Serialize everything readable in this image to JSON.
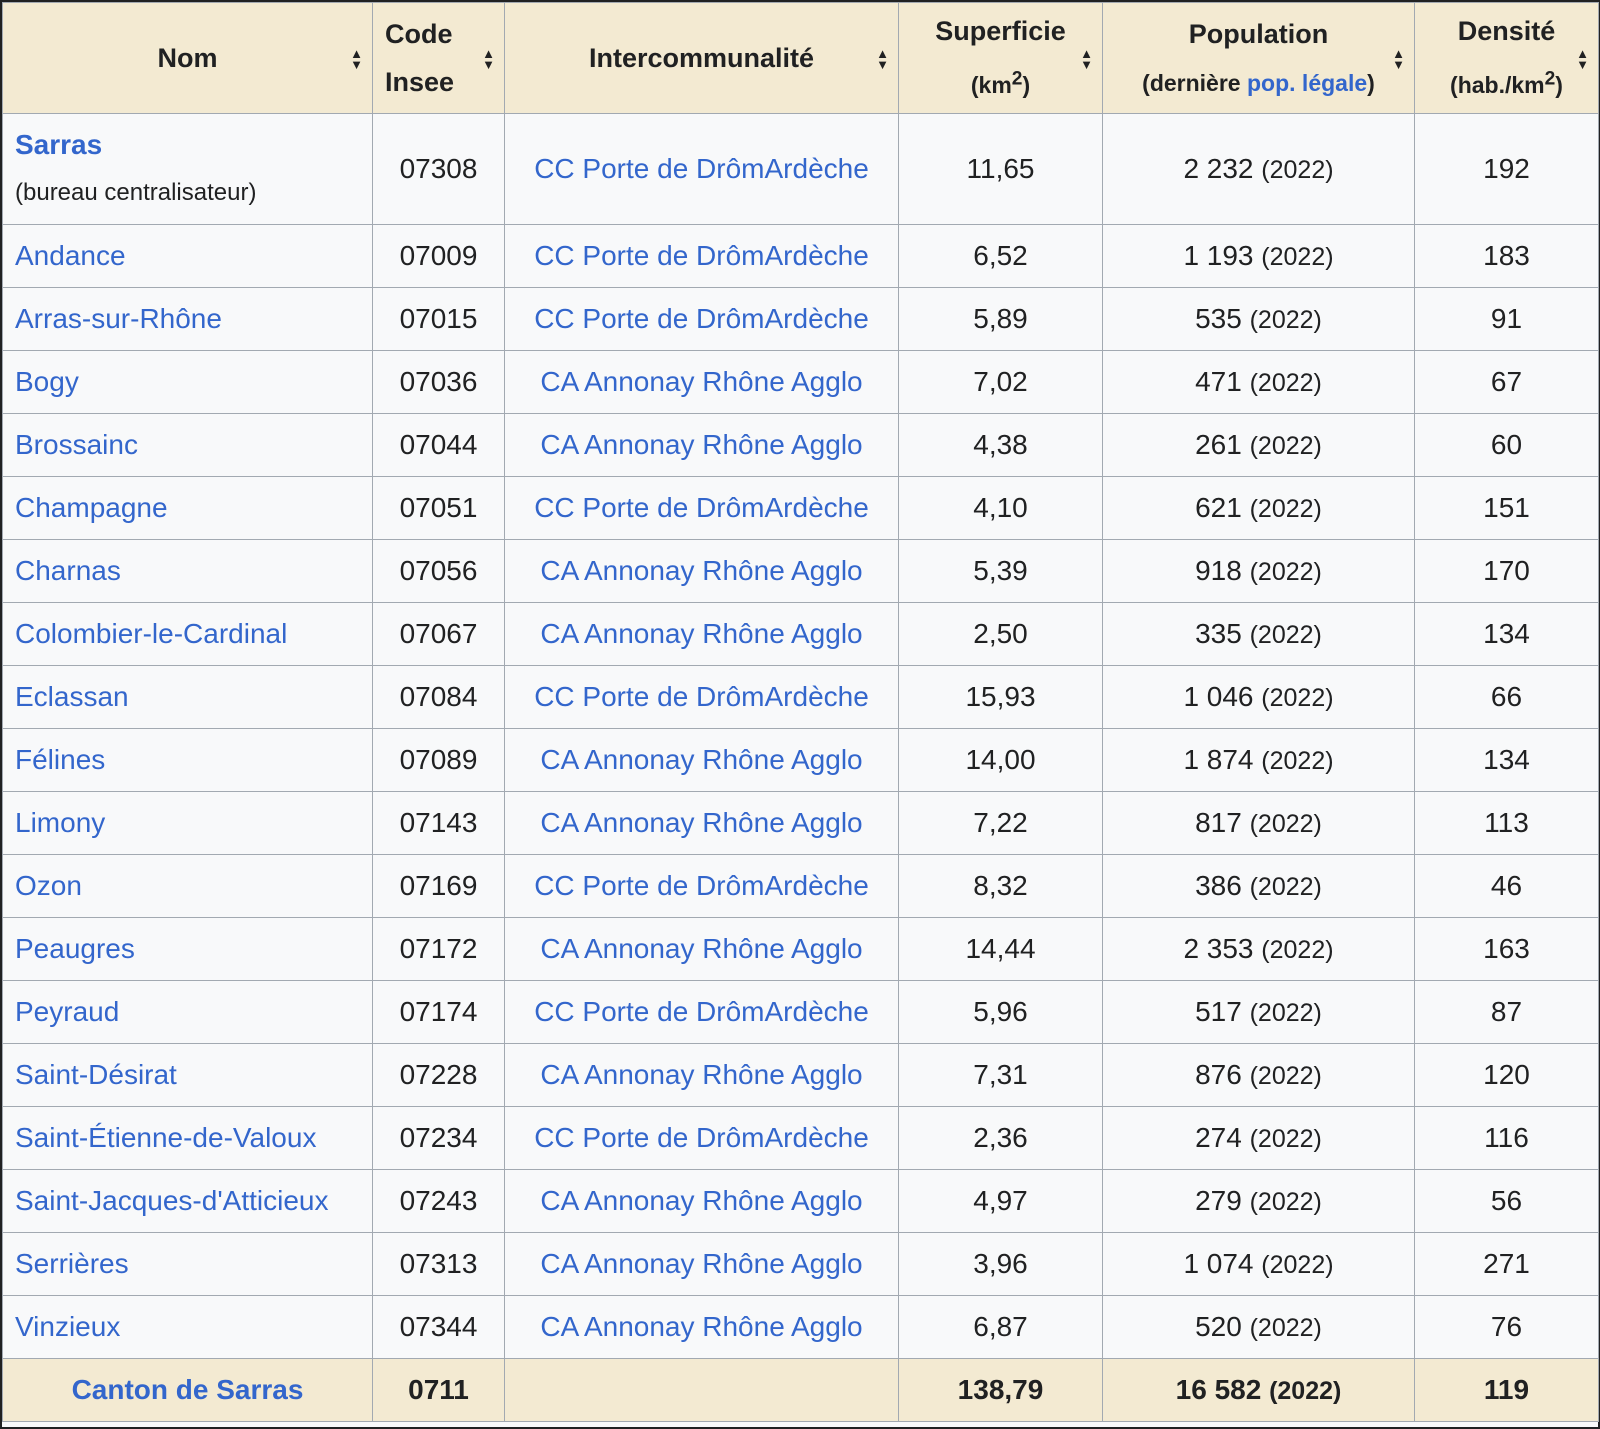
{
  "headers": {
    "nom": "Nom",
    "code_line1": "Code",
    "code_line2": "Insee",
    "inter": "Intercommunalité",
    "superficie": "Superficie",
    "superficie_unit_pre": "(km",
    "superficie_unit_sup": "2",
    "superficie_unit_post": ")",
    "population": "Population",
    "population_sub_pre": "(dernière ",
    "population_sub_link": "pop. légale",
    "population_sub_post": ")",
    "densite": "Densité",
    "densite_unit_pre": "(hab./km",
    "densite_unit_sup": "2",
    "densite_unit_post": ")"
  },
  "first_row": {
    "name": "Sarras",
    "note": "(bureau centralisateur)",
    "code": "07308",
    "inter": "CC Porte de DrômArdèche",
    "superficie": "11,65",
    "population": "2 232",
    "year": "(2022)",
    "densite": "192"
  },
  "rows": [
    {
      "name": "Andance",
      "code": "07009",
      "inter": "CC Porte de DrômArdèche",
      "superficie": "6,52",
      "population": "1 193",
      "year": "(2022)",
      "densite": "183"
    },
    {
      "name": "Arras-sur-Rhône",
      "code": "07015",
      "inter": "CC Porte de DrômArdèche",
      "superficie": "5,89",
      "population": "535",
      "year": "(2022)",
      "densite": "91"
    },
    {
      "name": "Bogy",
      "code": "07036",
      "inter": "CA Annonay Rhône Agglo",
      "superficie": "7,02",
      "population": "471",
      "year": "(2022)",
      "densite": "67"
    },
    {
      "name": "Brossainc",
      "code": "07044",
      "inter": "CA Annonay Rhône Agglo",
      "superficie": "4,38",
      "population": "261",
      "year": "(2022)",
      "densite": "60"
    },
    {
      "name": "Champagne",
      "code": "07051",
      "inter": "CC Porte de DrômArdèche",
      "superficie": "4,10",
      "population": "621",
      "year": "(2022)",
      "densite": "151"
    },
    {
      "name": "Charnas",
      "code": "07056",
      "inter": "CA Annonay Rhône Agglo",
      "superficie": "5,39",
      "population": "918",
      "year": "(2022)",
      "densite": "170"
    },
    {
      "name": "Colombier-le-Cardinal",
      "code": "07067",
      "inter": "CA Annonay Rhône Agglo",
      "superficie": "2,50",
      "population": "335",
      "year": "(2022)",
      "densite": "134"
    },
    {
      "name": "Eclassan",
      "code": "07084",
      "inter": "CC Porte de DrômArdèche",
      "superficie": "15,93",
      "population": "1 046",
      "year": "(2022)",
      "densite": "66"
    },
    {
      "name": "Félines",
      "code": "07089",
      "inter": "CA Annonay Rhône Agglo",
      "superficie": "14,00",
      "population": "1 874",
      "year": "(2022)",
      "densite": "134"
    },
    {
      "name": "Limony",
      "code": "07143",
      "inter": "CA Annonay Rhône Agglo",
      "superficie": "7,22",
      "population": "817",
      "year": "(2022)",
      "densite": "113"
    },
    {
      "name": "Ozon",
      "code": "07169",
      "inter": "CC Porte de DrômArdèche",
      "superficie": "8,32",
      "population": "386",
      "year": "(2022)",
      "densite": "46"
    },
    {
      "name": "Peaugres",
      "code": "07172",
      "inter": "CA Annonay Rhône Agglo",
      "superficie": "14,44",
      "population": "2 353",
      "year": "(2022)",
      "densite": "163"
    },
    {
      "name": "Peyraud",
      "code": "07174",
      "inter": "CC Porte de DrômArdèche",
      "superficie": "5,96",
      "population": "517",
      "year": "(2022)",
      "densite": "87"
    },
    {
      "name": "Saint-Désirat",
      "code": "07228",
      "inter": "CA Annonay Rhône Agglo",
      "superficie": "7,31",
      "population": "876",
      "year": "(2022)",
      "densite": "120"
    },
    {
      "name": "Saint-Étienne-de-Valoux",
      "code": "07234",
      "inter": "CC Porte de DrômArdèche",
      "superficie": "2,36",
      "population": "274",
      "year": "(2022)",
      "densite": "116"
    },
    {
      "name": "Saint-Jacques-d'Atticieux",
      "code": "07243",
      "inter": "CA Annonay Rhône Agglo",
      "superficie": "4,97",
      "population": "279",
      "year": "(2022)",
      "densite": "56"
    },
    {
      "name": "Serrières",
      "code": "07313",
      "inter": "CA Annonay Rhône Agglo",
      "superficie": "3,96",
      "population": "1 074",
      "year": "(2022)",
      "densite": "271"
    },
    {
      "name": "Vinzieux",
      "code": "07344",
      "inter": "CA Annonay Rhône Agglo",
      "superficie": "6,87",
      "population": "520",
      "year": "(2022)",
      "densite": "76"
    }
  ],
  "footer": {
    "name": "Canton de Sarras",
    "code": "0711",
    "inter": "",
    "superficie": "138,79",
    "population": "16 582",
    "year": "(2022)",
    "densite": "119"
  },
  "colors": {
    "link": "#3366cc",
    "header_bg": "#f3ead2",
    "cell_bg": "#f8f9fa",
    "border": "#a2a9b1"
  },
  "icons": {
    "sort": "sort-icon"
  }
}
